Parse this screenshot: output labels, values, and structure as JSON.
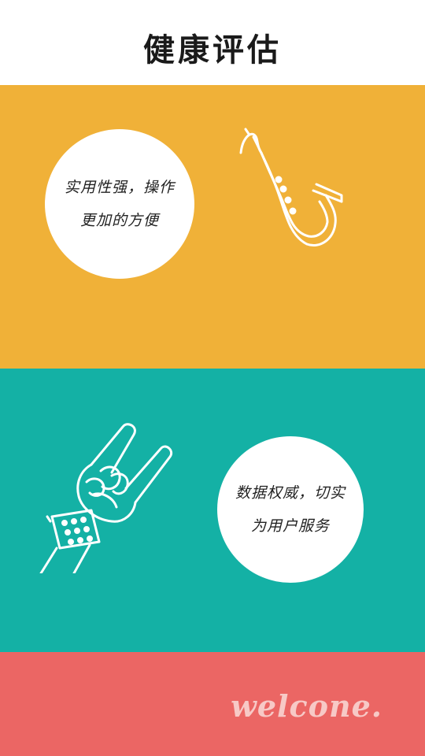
{
  "header": {
    "title": "健康评估"
  },
  "sections": [
    {
      "text": "实用性强，操作更加的方便",
      "icon": "saxophone-icon",
      "background": "#F0B138"
    },
    {
      "text": "数据权威，切实为用户服务",
      "icon": "rock-hand-icon",
      "background": "#14B1A5"
    }
  ],
  "footer": {
    "welcome": "welcone.",
    "background": "#EB6664"
  },
  "colors": {
    "yellow": "#F0B138",
    "teal": "#14B1A5",
    "coral": "#EB6664",
    "white": "#FFFFFF"
  }
}
